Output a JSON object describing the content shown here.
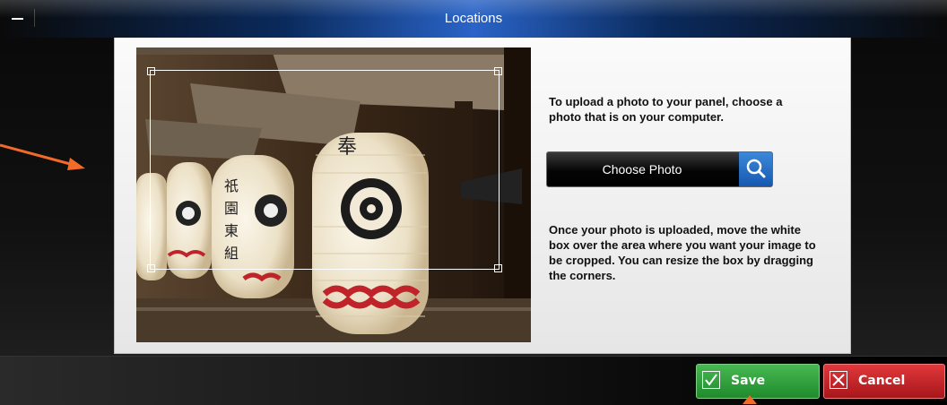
{
  "window": {
    "title": "Locations"
  },
  "upload": {
    "instructions": "To upload a photo to your panel, choose a photo that is on your computer.",
    "choose_label": "Choose Photo",
    "crop_instructions": "Once your photo is uploaded, move the white box over the area where you want your image to be cropped. You can resize the box by dragging the corners."
  },
  "actions": {
    "save_label": "Save",
    "cancel_label": "Cancel"
  },
  "icons": {
    "minimize": "minimize-icon",
    "search": "search-icon",
    "check": "checkmark-icon",
    "close": "close-icon"
  },
  "colors": {
    "save": "#2a9d38",
    "cancel": "#c7262a",
    "search": "#2a73c8",
    "annotation_arrow": "#f06a2a"
  }
}
